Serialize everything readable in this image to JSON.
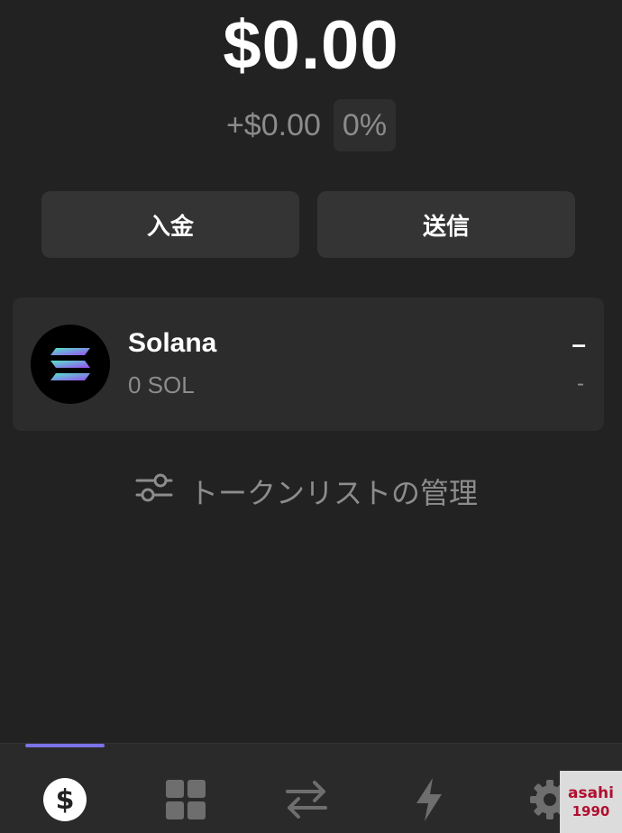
{
  "balance": {
    "total": "$0.00",
    "change_amount": "+$0.00",
    "change_percent": "0%"
  },
  "actions": {
    "deposit_label": "入金",
    "send_label": "送信"
  },
  "tokens": [
    {
      "name": "Solana",
      "amount": "0 SOL",
      "value": "–",
      "change": "-",
      "icon": "solana-logo"
    }
  ],
  "manage": {
    "label": "トークンリストの管理",
    "icon": "sliders-icon"
  },
  "tabbar": {
    "active": "wallet",
    "items": [
      {
        "id": "wallet",
        "icon": "dollar-icon"
      },
      {
        "id": "collectibles",
        "icon": "grid-icon"
      },
      {
        "id": "swap",
        "icon": "swap-arrows-icon"
      },
      {
        "id": "activity",
        "icon": "lightning-icon"
      },
      {
        "id": "settings",
        "icon": "gear-icon"
      }
    ]
  },
  "watermark": {
    "line1": "asahi",
    "line2": "1990"
  },
  "colors": {
    "background": "#222222",
    "card": "#2c2c2c",
    "accent": "#7b73e6",
    "muted": "#8c8c8c"
  }
}
